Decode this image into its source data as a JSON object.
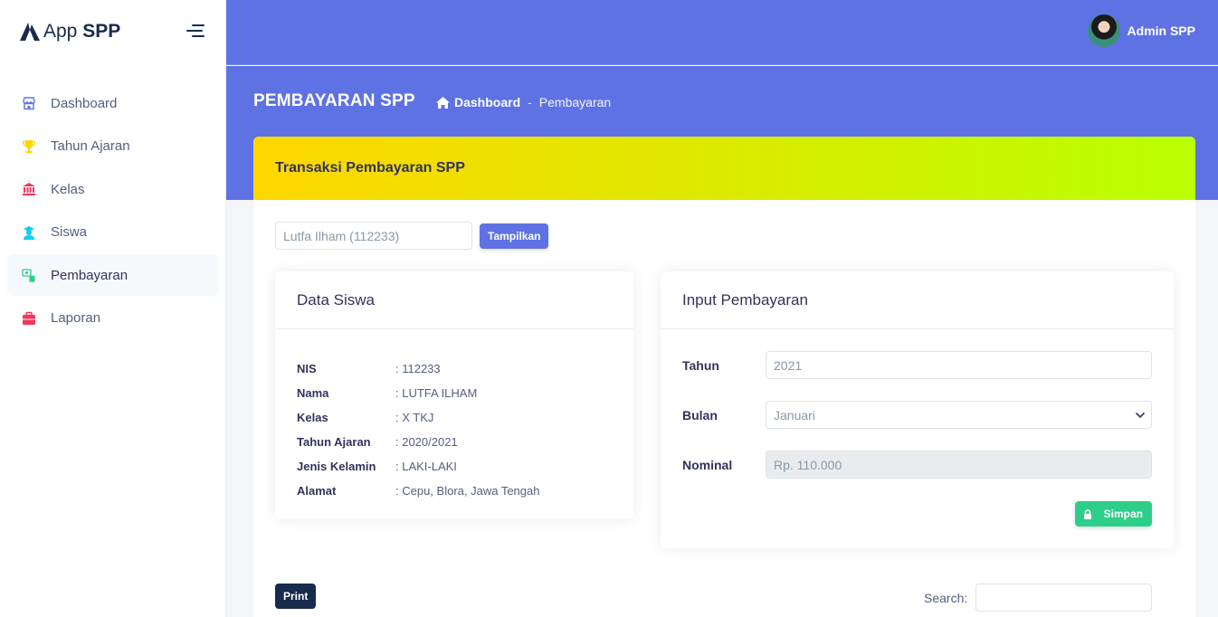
{
  "app": {
    "brand_prefix": "App",
    "brand_bold": "SPP"
  },
  "sidebar": {
    "items": [
      {
        "label": "Dashboard",
        "icon": "shop-icon",
        "color": "#5e72e4"
      },
      {
        "label": "Tahun Ajaran",
        "icon": "trophy-icon",
        "color": "#ffd600"
      },
      {
        "label": "Kelas",
        "icon": "building-icon",
        "color": "#f5365c"
      },
      {
        "label": "Siswa",
        "icon": "student-icon",
        "color": "#11cdef"
      },
      {
        "label": "Pembayaran",
        "icon": "money-coins-icon",
        "color": "#2dce89",
        "active": true
      },
      {
        "label": "Laporan",
        "icon": "briefcase-icon",
        "color": "#f5365c"
      }
    ]
  },
  "header": {
    "user_name": "Admin SPP"
  },
  "page": {
    "title": "PEMBAYARAN SPP",
    "breadcrumb_home": "Dashboard",
    "breadcrumb_separator": "-",
    "breadcrumb_current": "Pembayaran"
  },
  "card": {
    "title": "Transaksi Pembayaran SPP"
  },
  "search": {
    "student_value": "Lutfa Ilham (112233)",
    "button": "Tampilkan"
  },
  "data_siswa": {
    "title": "Data Siswa",
    "rows": [
      {
        "key": "NIS",
        "value": ": 112233"
      },
      {
        "key": "Nama",
        "value": ": LUTFA ILHAM"
      },
      {
        "key": "Kelas",
        "value": ": X TKJ"
      },
      {
        "key": "Tahun Ajaran",
        "value": ": 2020/2021"
      },
      {
        "key": "Jenis Kelamin",
        "value": ": LAKI-LAKI"
      },
      {
        "key": "Alamat",
        "value": ": Cepu, Blora, Jawa Tengah"
      }
    ]
  },
  "input_pembayaran": {
    "title": "Input Pembayaran",
    "tahun_label": "Tahun",
    "tahun_value": "2021",
    "bulan_label": "Bulan",
    "bulan_value": "Januari",
    "nominal_label": "Nominal",
    "nominal_value": "Rp. 110.000",
    "save_button": "Simpan"
  },
  "table_controls": {
    "print_button": "Print",
    "search_label": "Search:"
  },
  "colors": {
    "primary": "#5e72e4",
    "success": "#2dce89",
    "dark": "#172b4d",
    "gradient_start": "#ffd600",
    "gradient_end": "#b9ff00"
  }
}
